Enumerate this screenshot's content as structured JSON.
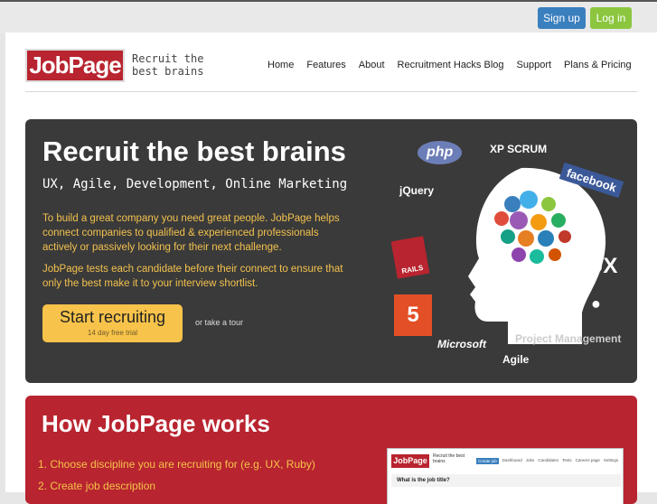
{
  "auth": {
    "signup": "Sign up",
    "login": "Log in"
  },
  "brand": {
    "logo": "JobPage",
    "tagline": "Recruit the best brains"
  },
  "nav": [
    "Home",
    "Features",
    "About",
    "Recruitment Hacks Blog",
    "Support",
    "Plans & Pricing"
  ],
  "hero": {
    "title": "Recruit the best brains",
    "subtitle": "UX, Agile, Development, Online Marketing",
    "p1": "To build a great company you need great people. JobPage helps connect companies to qualified & experienced professionals actively or passively looking for their next challenge.",
    "p2": "JobPage tests each candidate before their connect to ensure that only the best make it to your interview shortlist.",
    "cta_main": "Start recruiting",
    "cta_sub": "14 day free trial",
    "tour": "or take a tour",
    "tech_labels": [
      "php",
      "XP SCRUM",
      "facebook",
      "jQuery",
      "RAILS",
      "UX",
      "Microsoft",
      "Project Management",
      "Agile"
    ]
  },
  "works": {
    "title": "How JobPage works",
    "steps": [
      "1. Choose discipline you are recruiting for (e.g. UX, Ruby)",
      "2. Create job description"
    ],
    "preview": {
      "logo": "JobPage",
      "tagline": "Recruit the best brains",
      "nav": [
        "Create job",
        "Dashboard",
        "Jobs",
        "Candidates",
        "Tests",
        "Careers page",
        "Settings"
      ],
      "question": "What is the job title?"
    }
  }
}
